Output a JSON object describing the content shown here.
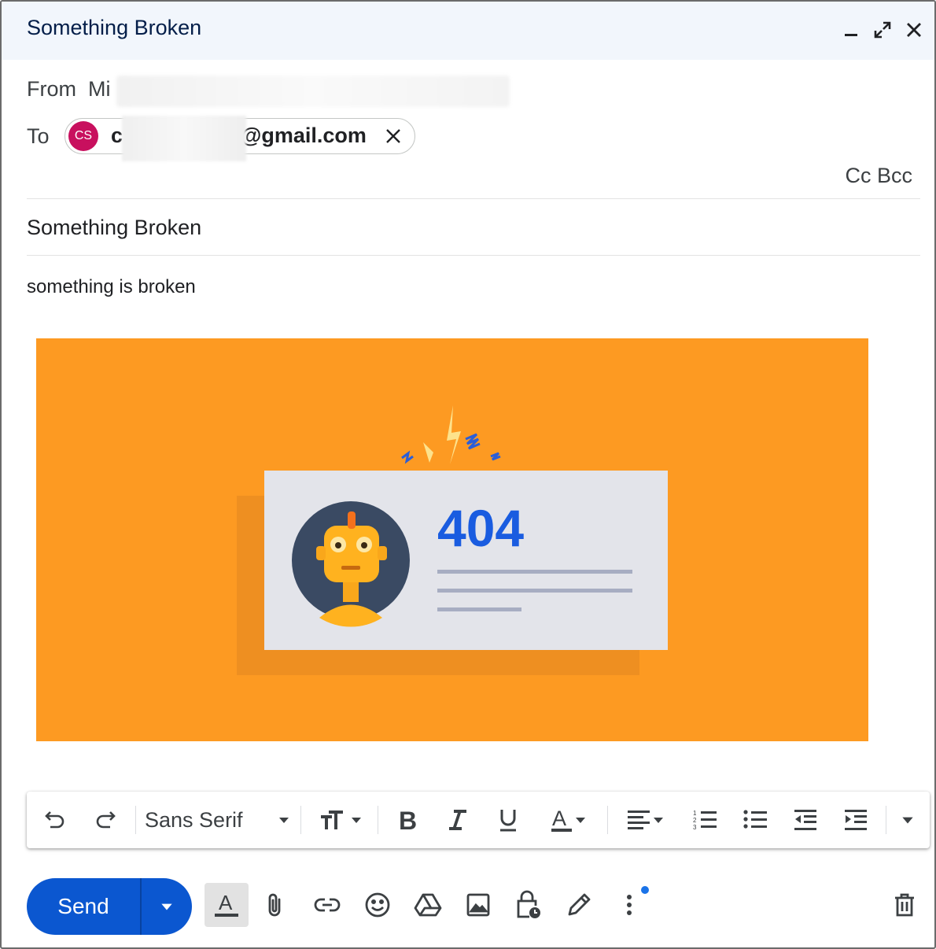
{
  "window": {
    "title": "Something Broken"
  },
  "compose": {
    "from_label": "From",
    "from_value": "Mi",
    "to_label": "To",
    "recipient": {
      "initials": "CS",
      "email_prefix": "c",
      "email_suffix": "@gmail.com"
    },
    "cc_label": "Cc",
    "bcc_label": "Bcc",
    "subject": "Something Broken",
    "body": "something is broken"
  },
  "image": {
    "error_code": "404",
    "colors": {
      "background": "#fd9a22",
      "card": "#e3e4ea",
      "code": "#1a5ce0",
      "robot_circle": "#3a4a63"
    }
  },
  "formatting": {
    "font_name": "Sans Serif"
  },
  "actions": {
    "send_label": "Send"
  },
  "colors": {
    "accent": "#0b57d0",
    "avatar": "#c8105e",
    "titlebar": "#f2f6fc"
  }
}
